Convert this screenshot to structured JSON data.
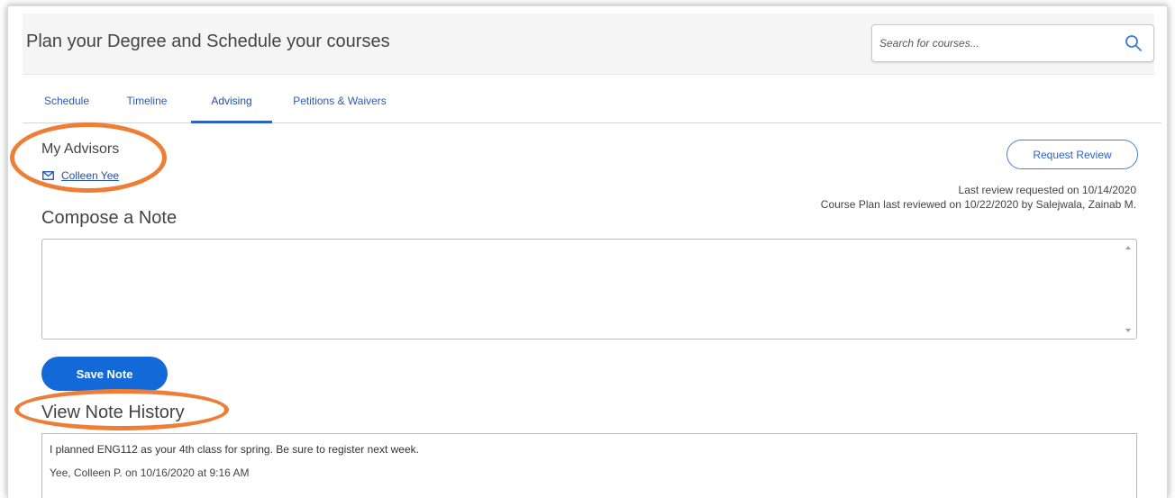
{
  "header": {
    "title": "Plan your Degree and Schedule your courses",
    "search_placeholder": "Search for courses..."
  },
  "tabs": [
    {
      "label": "Schedule",
      "active": false
    },
    {
      "label": "Timeline",
      "active": false
    },
    {
      "label": "Advising",
      "active": true
    },
    {
      "label": "Petitions & Waivers",
      "active": false
    }
  ],
  "advisors": {
    "title": "My Advisors",
    "items": [
      {
        "name": "Colleen Yee",
        "icon": "mail-icon"
      }
    ]
  },
  "review": {
    "button_label": "Request Review",
    "last_requested": "Last review requested on 10/14/2020",
    "last_reviewed": "Course Plan last reviewed on 10/22/2020 by Salejwala, Zainab M."
  },
  "compose": {
    "title": "Compose a Note",
    "value": "",
    "save_label": "Save Note"
  },
  "history": {
    "title": "View Note History",
    "notes": [
      {
        "text": "I planned ENG112 as your 4th class for spring. Be sure to register next week.",
        "meta": "Yee, Colleen P. on 10/16/2020 at 9:16 AM"
      }
    ]
  },
  "colors": {
    "accent": "#1469d9",
    "link": "#1f4fb3",
    "highlight": "#ee7d35"
  }
}
